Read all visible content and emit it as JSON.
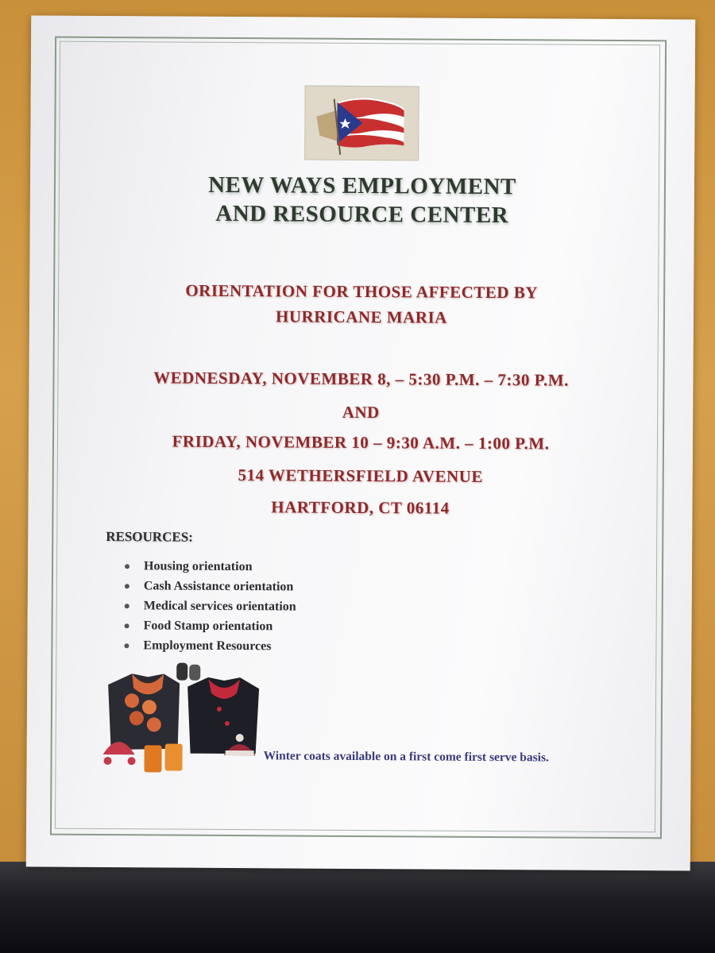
{
  "title": [
    "NEW WAYS EMPLOYMENT",
    "AND RESOURCE CENTER"
  ],
  "subtitle": [
    "ORIENTATION FOR THOSE AFFECTED BY",
    "HURRICANE MARIA"
  ],
  "schedule": {
    "line1": "WEDNESDAY, NOVEMBER 8, – 5:30 P.M. – 7:30 P.M.",
    "and": "AND",
    "line2": "FRIDAY, NOVEMBER 10 – 9:30 A.M. – 1:00 P.M."
  },
  "address": {
    "street": "514 WETHERSFIELD AVENUE",
    "city": "HARTFORD, CT 06114"
  },
  "resources": {
    "label": "RESOURCES:",
    "items": [
      "Housing orientation",
      "Cash Assistance orientation",
      "Medical services orientation",
      "Food Stamp orientation",
      "Employment Resources"
    ]
  },
  "footer_note": "Winter coats available on a first come first serve basis.",
  "icons": [
    "puerto-rico-flag-icon",
    "winter-clothing-icon"
  ],
  "colors": {
    "title": "#2f3a2f",
    "accent_red": "#8c2a2a",
    "note_blue": "#3a3a78",
    "frame": "#8a9a8a"
  }
}
